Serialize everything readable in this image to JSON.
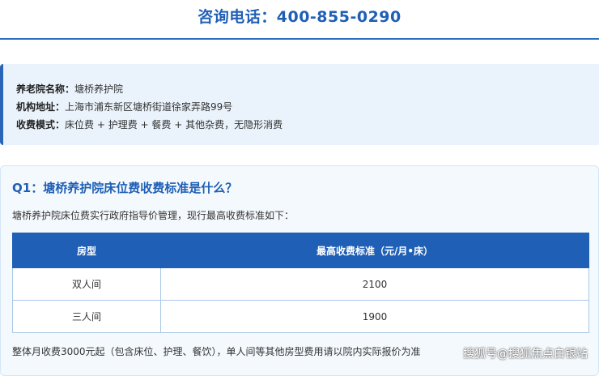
{
  "header": {
    "phone_text": "咨询电话：400-855-0290"
  },
  "info": {
    "name_label": "养老院名称：",
    "name_value": "塘桥养护院",
    "address_label": "机构地址：",
    "address_value": "上海市浦东新区塘桥街道徐家弄路99号",
    "fee_label": "收费模式：",
    "fee_value": "床位费 + 护理费 + 餐费 + 其他杂费，无隐形消费"
  },
  "qa": {
    "title": "Q1：塘桥养护院床位费收费标准是什么？",
    "desc": "塘桥养护院床位费实行政府指导价管理，现行最高收费标准如下：",
    "table": {
      "headers": [
        "房型",
        "最高收费标准（元/月•床）"
      ],
      "rows": [
        {
          "room": "双人间",
          "price": "2100"
        },
        {
          "room": "三人间",
          "price": "1900"
        }
      ]
    },
    "note": "整体月收费3000元起（包含床位、护理、餐饮），单人间等其他房型费用请以院内实际报价为准"
  },
  "watermark": "搜狐号@搜狐焦点白银站",
  "colors": {
    "accent": "#1f5fb5",
    "info_bg": "#eaf3fb",
    "panel_bg": "#f4f9fd"
  }
}
